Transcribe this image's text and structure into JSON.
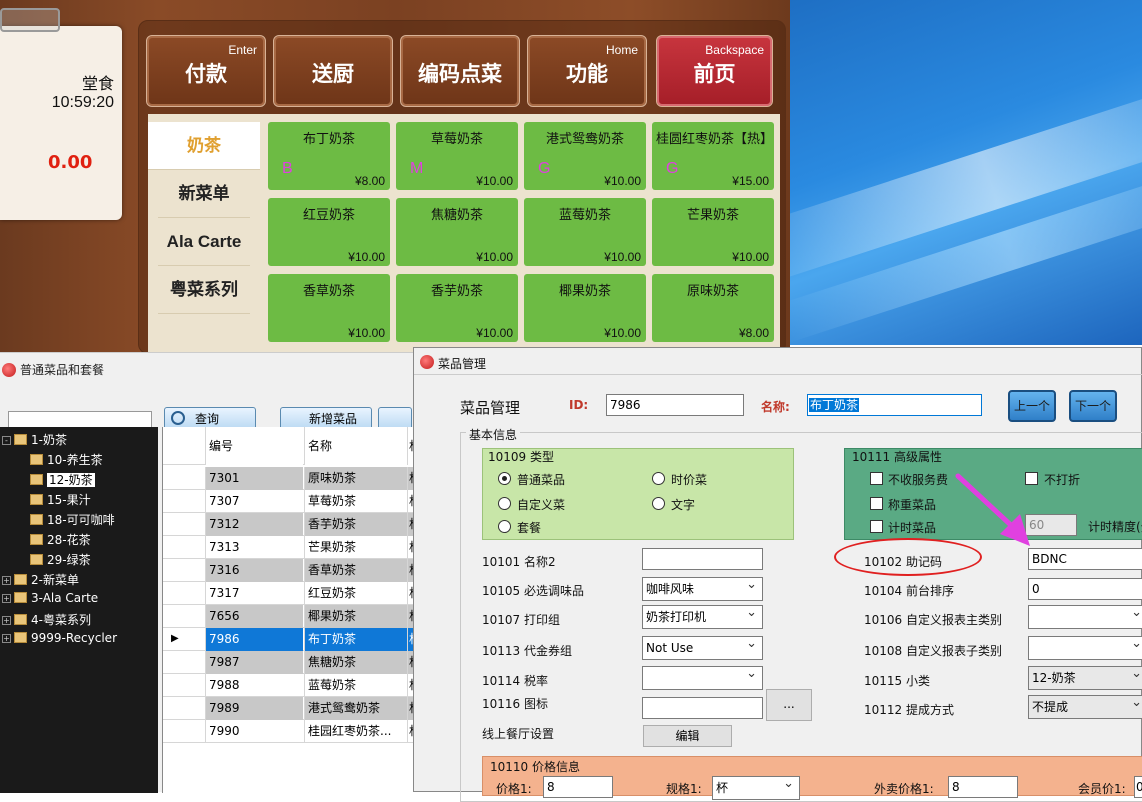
{
  "pos": {
    "ticket": {
      "dine_type": "堂食",
      "time": "10:59:20",
      "amount": "0.00"
    },
    "top_buttons": [
      {
        "label": "付款",
        "key": "Enter"
      },
      {
        "label": "送厨",
        "key": ""
      },
      {
        "label": "编码点菜",
        "key": ""
      },
      {
        "label": "功能",
        "key": "Home"
      },
      {
        "label": "前页",
        "key": "Backspace"
      }
    ],
    "categories": [
      "奶茶",
      "新菜单",
      "Ala Carte",
      "粤菜系列"
    ],
    "items": [
      {
        "name": "布丁奶茶",
        "price": "¥8.00",
        "code": "B"
      },
      {
        "name": "草莓奶茶",
        "price": "¥10.00",
        "code": "M"
      },
      {
        "name": "港式鸳鸯奶茶",
        "price": "¥10.00",
        "code": "G"
      },
      {
        "name": "桂圆红枣奶茶【热】",
        "price": "¥15.00",
        "code": "G"
      },
      {
        "name": "红豆奶茶",
        "price": "¥10.00",
        "code": ""
      },
      {
        "name": "焦糖奶茶",
        "price": "¥10.00",
        "code": ""
      },
      {
        "name": "蓝莓奶茶",
        "price": "¥10.00",
        "code": ""
      },
      {
        "name": "芒果奶茶",
        "price": "¥10.00",
        "code": ""
      },
      {
        "name": "香草奶茶",
        "price": "¥10.00",
        "code": ""
      },
      {
        "name": "香芋奶茶",
        "price": "¥10.00",
        "code": ""
      },
      {
        "name": "椰果奶茶",
        "price": "¥10.00",
        "code": ""
      },
      {
        "name": "原味奶茶",
        "price": "¥8.00",
        "code": ""
      }
    ]
  },
  "list_window": {
    "title": "普通菜品和套餐",
    "search_button": "查询",
    "new_button": "新增菜品",
    "tree": [
      {
        "label": "1-奶茶",
        "level": 0,
        "exp": "-"
      },
      {
        "label": "10-养生茶",
        "level": 1
      },
      {
        "label": "12-奶茶",
        "level": 1,
        "selected": true
      },
      {
        "label": "15-果汁",
        "level": 1
      },
      {
        "label": "18-可可咖啡",
        "level": 1
      },
      {
        "label": "28-花茶",
        "level": 1
      },
      {
        "label": "29-绿茶",
        "level": 1
      },
      {
        "label": "2-新菜单",
        "level": 0,
        "exp": "+"
      },
      {
        "label": "3-Ala Carte",
        "level": 0,
        "exp": "+"
      },
      {
        "label": "4-粤菜系列",
        "level": 0,
        "exp": "+"
      },
      {
        "label": "9999-Recycler",
        "level": 0,
        "exp": "+"
      }
    ],
    "columns": [
      "编号",
      "名称",
      "杯"
    ],
    "rows": [
      {
        "id": "7301",
        "name": "原味奶茶",
        "unit": "杯"
      },
      {
        "id": "7307",
        "name": "草莓奶茶",
        "unit": "杯"
      },
      {
        "id": "7312",
        "name": "香芋奶茶",
        "unit": "杯"
      },
      {
        "id": "7313",
        "name": "芒果奶茶",
        "unit": "杯"
      },
      {
        "id": "7316",
        "name": "香草奶茶",
        "unit": "杯"
      },
      {
        "id": "7317",
        "name": "红豆奶茶",
        "unit": "杯"
      },
      {
        "id": "7656",
        "name": "椰果奶茶",
        "unit": "杯"
      },
      {
        "id": "7986",
        "name": "布丁奶茶",
        "unit": "杯"
      },
      {
        "id": "7987",
        "name": "焦糖奶茶",
        "unit": "杯"
      },
      {
        "id": "7988",
        "name": "蓝莓奶茶",
        "unit": "杯"
      },
      {
        "id": "7989",
        "name": "港式鸳鸯奶茶",
        "unit": "杯"
      },
      {
        "id": "7990",
        "name": "桂园红枣奶茶...",
        "unit": "杯"
      }
    ]
  },
  "dialog": {
    "title": "菜品管理",
    "heading": "菜品管理",
    "id_label": "ID:",
    "id_value": "7986",
    "name_label": "名称:",
    "name_value": "布丁奶茶",
    "prev_button": "上一个",
    "next_button": "下一个",
    "basic_group": "基本信息",
    "type_group": "10109 类型",
    "types": [
      "普通菜品",
      "时价菜",
      "自定义菜",
      "文字",
      "套餐"
    ],
    "adv_group": "10111 高级属性",
    "adv": {
      "no_service": "不收服务费",
      "no_discount": "不打折",
      "weigh": "称重菜品",
      "timed": "计时菜品",
      "timed_value": "60",
      "timed_precision": "计时精度(分"
    },
    "fields_left": [
      {
        "label": "10101 名称2",
        "value": ""
      },
      {
        "label": "10105 必选调味品",
        "value": "咖啡风味"
      },
      {
        "label": "10107 打印组",
        "value": "奶茶打印机"
      },
      {
        "label": "10113 代金券组",
        "value": "Not Use"
      },
      {
        "label": "10114 税率",
        "value": ""
      },
      {
        "label": "10116 图标",
        "value": ""
      },
      {
        "label": "线上餐厅设置",
        "value": "编辑"
      }
    ],
    "icon_browse": "...",
    "fields_right": [
      {
        "label": "10102 助记码",
        "value": "BDNC"
      },
      {
        "label": "10104 前台排序",
        "value": "0"
      },
      {
        "label": "10106 自定义报表主类别",
        "value": ""
      },
      {
        "label": "10108 自定义报表子类别",
        "value": ""
      },
      {
        "label": "10115 小类",
        "value": "12-奶茶"
      },
      {
        "label": "10112 提成方式",
        "value": "不提成"
      }
    ],
    "price_group": "10110 价格信息",
    "price": {
      "p1_label": "价格1:",
      "p1": "8",
      "spec_label": "规格1:",
      "spec": "杯",
      "out_label": "外卖价格1:",
      "out": "8",
      "member_label": "会员价1:",
      "member": "0"
    }
  },
  "colors": {
    "accent_green": "#6dbb44",
    "wood": "#7b4122",
    "annotation": "#e040e0",
    "circle": "#e02020"
  }
}
